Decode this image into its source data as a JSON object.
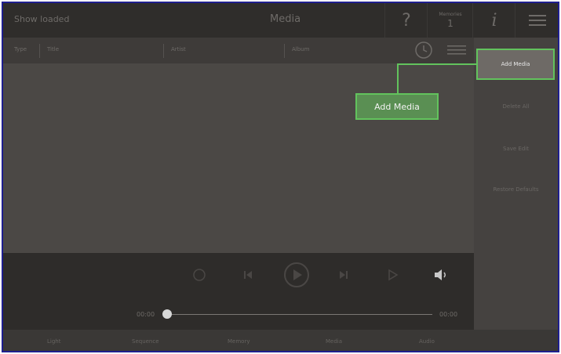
{
  "topbar": {
    "status": "Show loaded",
    "title": "Media",
    "help_icon": "?",
    "memories_label": "Memories",
    "memories_count": "1",
    "info_icon": "i"
  },
  "columns": [
    "Type",
    "Title",
    "Artist",
    "Album"
  ],
  "sidebar": {
    "items": [
      "Add Media",
      "Delete All",
      "Save Edit",
      "Restore Defaults"
    ]
  },
  "callout": {
    "label": "Add Media"
  },
  "player": {
    "time_current": "00:00",
    "time_total": "00:00",
    "progress": 0
  },
  "bottom_nav": [
    "Light",
    "Sequence",
    "Memory",
    "Media",
    "Audio"
  ],
  "colors": {
    "highlight": "#62c35d",
    "callout_fill": "#5a8f53",
    "background": "#4b4845",
    "topbar": "#2f2d2b",
    "frame_border": "#1f1f8f"
  }
}
